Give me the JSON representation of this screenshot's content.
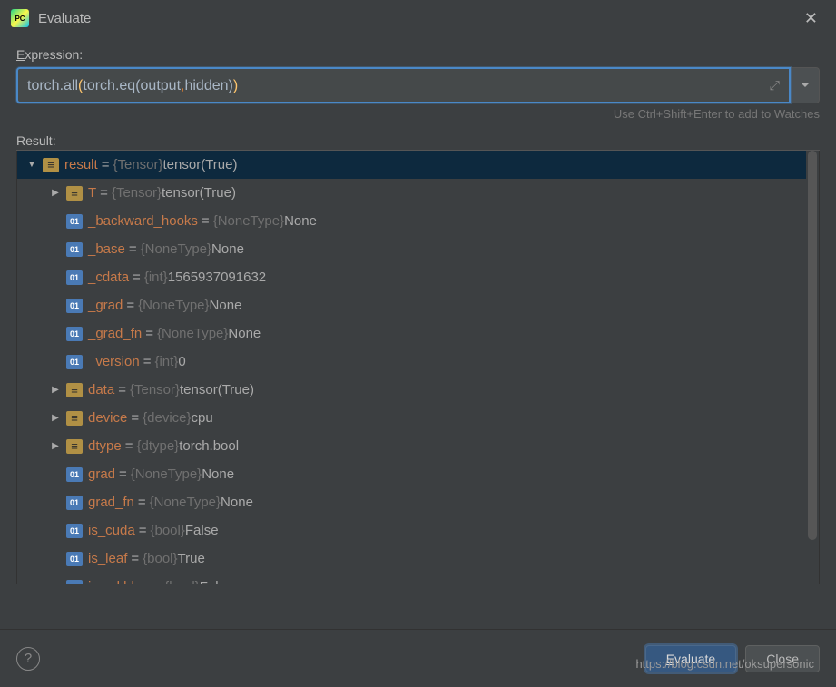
{
  "titlebar": {
    "title": "Evaluate"
  },
  "labels": {
    "expression": "Expression:",
    "result": "Result:",
    "hint": "Use Ctrl+Shift+Enter to add to Watches"
  },
  "expression": {
    "tokens": [
      {
        "t": "torch",
        "c": "code-torch"
      },
      {
        "t": ".",
        "c": "code-dot"
      },
      {
        "t": "all",
        "c": "code-fn"
      },
      {
        "t": "(",
        "c": "code-paren-y"
      },
      {
        "t": "torch",
        "c": "code-torch"
      },
      {
        "t": ".",
        "c": "code-dot"
      },
      {
        "t": "eq",
        "c": "code-fn"
      },
      {
        "t": "(",
        "c": "code-paren-w"
      },
      {
        "t": "output",
        "c": "code-torch"
      },
      {
        "t": ",",
        "c": "code-comma"
      },
      {
        "t": "hidden",
        "c": "code-torch"
      },
      {
        "t": ")",
        "c": "code-paren-w"
      },
      {
        "t": ")",
        "c": "code-paren-y"
      }
    ]
  },
  "tree": [
    {
      "depth": 0,
      "arrow": "down",
      "icon": "obj",
      "name": "result",
      "type": "{Tensor}",
      "value": "tensor(True)",
      "selected": true
    },
    {
      "depth": 1,
      "arrow": "right",
      "icon": "obj",
      "name": "T",
      "type": "{Tensor}",
      "value": "tensor(True)"
    },
    {
      "depth": 1,
      "arrow": "none",
      "icon": "prim",
      "name": "_backward_hooks",
      "type": "{NoneType}",
      "value": "None"
    },
    {
      "depth": 1,
      "arrow": "none",
      "icon": "prim",
      "name": "_base",
      "type": "{NoneType}",
      "value": "None"
    },
    {
      "depth": 1,
      "arrow": "none",
      "icon": "prim",
      "name": "_cdata",
      "type": "{int}",
      "value": "1565937091632"
    },
    {
      "depth": 1,
      "arrow": "none",
      "icon": "prim",
      "name": "_grad",
      "type": "{NoneType}",
      "value": "None"
    },
    {
      "depth": 1,
      "arrow": "none",
      "icon": "prim",
      "name": "_grad_fn",
      "type": "{NoneType}",
      "value": "None"
    },
    {
      "depth": 1,
      "arrow": "none",
      "icon": "prim",
      "name": "_version",
      "type": "{int}",
      "value": "0"
    },
    {
      "depth": 1,
      "arrow": "right",
      "icon": "obj",
      "name": "data",
      "type": "{Tensor}",
      "value": "tensor(True)"
    },
    {
      "depth": 1,
      "arrow": "right",
      "icon": "obj",
      "name": "device",
      "type": "{device}",
      "value": "cpu"
    },
    {
      "depth": 1,
      "arrow": "right",
      "icon": "obj",
      "name": "dtype",
      "type": "{dtype}",
      "value": "torch.bool"
    },
    {
      "depth": 1,
      "arrow": "none",
      "icon": "prim",
      "name": "grad",
      "type": "{NoneType}",
      "value": "None"
    },
    {
      "depth": 1,
      "arrow": "none",
      "icon": "prim",
      "name": "grad_fn",
      "type": "{NoneType}",
      "value": "None"
    },
    {
      "depth": 1,
      "arrow": "none",
      "icon": "prim",
      "name": "is_cuda",
      "type": "{bool}",
      "value": "False"
    },
    {
      "depth": 1,
      "arrow": "none",
      "icon": "prim",
      "name": "is_leaf",
      "type": "{bool}",
      "value": "True"
    },
    {
      "depth": 1,
      "arrow": "none",
      "icon": "prim",
      "name": "is_mkldnn",
      "type": "{bool}",
      "value": "False"
    }
  ],
  "buttons": {
    "evaluate": "Evaluate",
    "close": "Close",
    "help": "?"
  },
  "watermark": "https://blog.csdn.net/oksupersonic"
}
